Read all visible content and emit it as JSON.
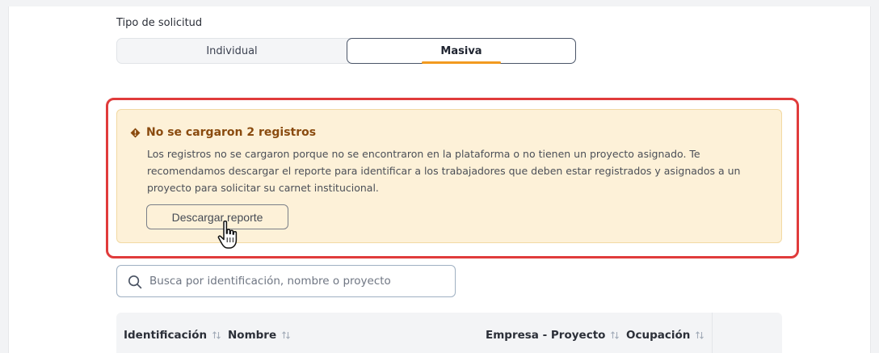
{
  "request_type": {
    "label": "Tipo de solicitud",
    "options": [
      {
        "label": "Individual",
        "selected": false
      },
      {
        "label": "Masiva",
        "selected": true
      }
    ]
  },
  "alert": {
    "icon": "warning-diamond-icon",
    "title": "No se cargaron 2 registros",
    "message": "Los registros no se cargaron porque no se encontraron en la plataforma o no tienen un proyecto asignado. Te recomendamos descargar el reporte para identificar a los trabajadores que deben estar registrados y asignados a un proyecto para solicitar su carnet institucional.",
    "download_label": "Descargar reporte"
  },
  "search": {
    "value": "",
    "placeholder": "Busca por identificación, nombre o proyecto"
  },
  "table": {
    "columns": [
      {
        "label": "Identificación"
      },
      {
        "label": "Nombre"
      },
      {
        "label": "Empresa - Proyecto"
      },
      {
        "label": "Ocupación"
      }
    ]
  },
  "colors": {
    "accent": "#f29a1f",
    "alert_bg": "#fdf1d8",
    "alert_title": "#8a4b0f",
    "highlight_frame": "#e03b3b"
  }
}
